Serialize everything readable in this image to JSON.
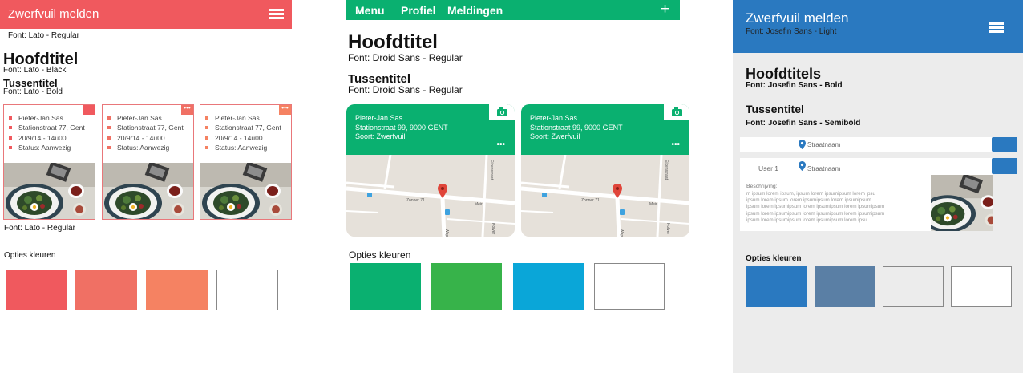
{
  "panel1": {
    "header_title": "Zwerfvuil melden",
    "header_font_caption": "Font: Lato - Regular",
    "heading": "Hoofdtitel",
    "heading_caption": "Font: Lato - Black",
    "subheading": "Tussentitel",
    "subheading_caption": "Font: Lato - Bold",
    "card_caption": "Font: Lato - Regular",
    "cards": [
      {
        "lines": [
          "Pieter-Jan Sas",
          "Stationstraat 77, Gent",
          "20/9/14 - 14u00",
          "Status: Aanwezig"
        ],
        "accent": "#f0595e"
      },
      {
        "lines": [
          "Pieter-Jan Sas",
          "Stationstraat 77, Gent",
          "20/9/14 - 14u00",
          "Status: Aanwezig"
        ],
        "accent": "#f07064",
        "corner": "•••"
      },
      {
        "lines": [
          "Pieter-Jan Sas",
          "Stationstraat 77, Gent",
          "20/9/14 - 14u00",
          "Status: Aanwezig"
        ],
        "accent": "#f58262",
        "corner": "•••"
      }
    ],
    "colors_label": "Opties kleuren",
    "colors": [
      "#f0595e",
      "#f07064",
      "#f58262",
      "#ffffff"
    ]
  },
  "panel2": {
    "nav": [
      "Menu",
      "Profiel",
      "Meldingen"
    ],
    "plus": "+",
    "heading": "Hoofdtitel",
    "heading_caption": "Font: Droid Sans - Regular",
    "subheading": "Tussentitel",
    "subheading_caption": "Font: Droid Sans - Regular",
    "cards": [
      {
        "lines": [
          "Pieter-Jan Sas",
          "Stationstraat 99, 9000 GENT",
          "Soort: Zwerfvuil"
        ],
        "more": "•••",
        "map_labels": {
          "street_a": "Zonner 71",
          "street_b": "Meir",
          "street_c": "Wapp",
          "street_d": "Eikenstraat",
          "street_e": "Kolver"
        }
      },
      {
        "lines": [
          "Pieter-Jan Sas",
          "Stationstraat 99, 9000 GENT",
          "Soort: Zwerfvuil"
        ],
        "more": "•••",
        "map_labels": {
          "street_a": "Zonner 71",
          "street_b": "Meir",
          "street_c": "Wapp",
          "street_d": "Eikenstraat",
          "street_e": "Kolver"
        }
      }
    ],
    "colors_label": "Opties kleuren",
    "colors": [
      "#0ab070",
      "#37b34a",
      "#0aa6d8",
      "#ffffff"
    ]
  },
  "panel3": {
    "header_title": "Zwerfvuil melden",
    "header_font_caption": "Font: Josefin Sans - Light",
    "heading": "Hoofdtitels",
    "heading_caption": "Font: Josefin Sans - Bold",
    "subheading": "Tussentitel",
    "subheading_caption": "Font: Josefin Sans - Semibold",
    "row1_street": "Straatnaam",
    "row2_user": "User 1",
    "row2_street": "Straatnaam",
    "description_label": "Beschrijving:",
    "lorem_lines": [
      "m ipsum lorem ipsum, ipsum lorem ipsumipsum lorem ipsu",
      "ipsum lorem ipsum lorem ipsumipsum lorem ipsumipsum",
      "ipsum lorem ipsumipsum lorem ipsumipsum lorem ipsumipsum",
      "ipsum lorem ipsumipsum lorem ipsumipsum lorem ipsumipsum",
      "ipsum lorem ipsumipsum lorem ipsumipsum lorem ipsu"
    ],
    "colors_label": "Opties kleuren",
    "colors": [
      "#2a79c0",
      "#5a7fa5",
      "#ececec",
      "#ffffff"
    ]
  }
}
